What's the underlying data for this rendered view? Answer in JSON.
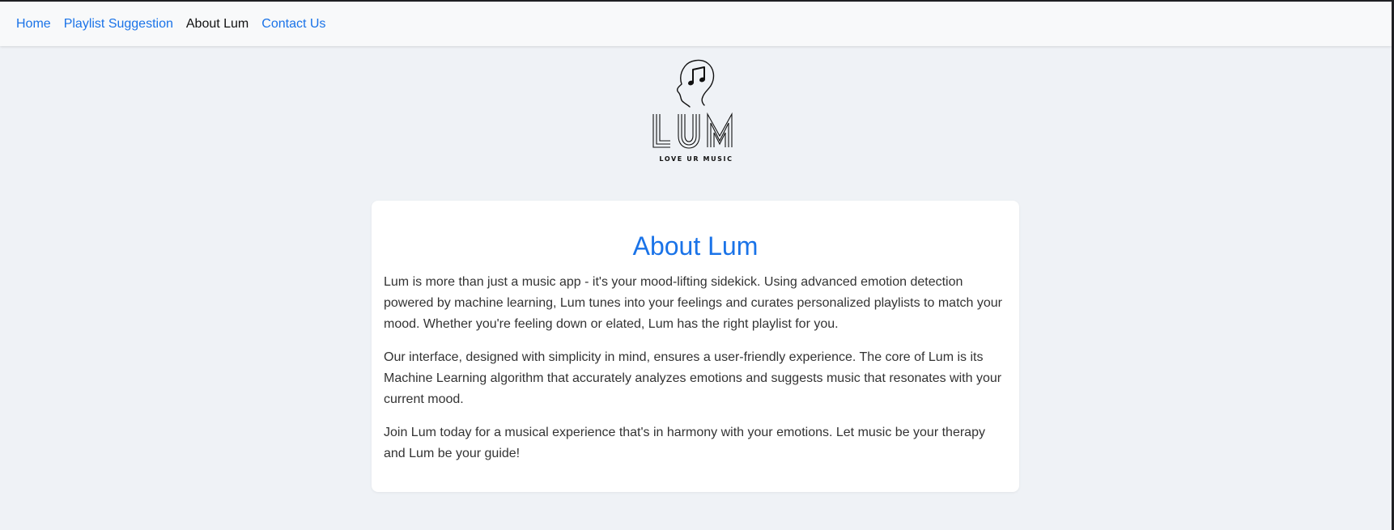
{
  "nav": {
    "items": [
      {
        "label": "Home",
        "active": false
      },
      {
        "label": "Playlist Suggestion",
        "active": false
      },
      {
        "label": "About Lum",
        "active": true
      },
      {
        "label": "Contact Us",
        "active": false
      }
    ]
  },
  "logo": {
    "name": "LUM",
    "tagline": "LOVE UR MUSIC",
    "icon": "head-with-music-note-icon"
  },
  "about": {
    "title": "About Lum",
    "paragraphs": [
      "Lum is more than just a music app - it's your mood-lifting sidekick. Using advanced emotion detection powered by machine learning, Lum tunes into your feelings and curates personalized playlists to match your mood. Whether you're feeling down or elated, Lum has the right playlist for you.",
      "Our interface, designed with simplicity in mind, ensures a user-friendly experience. The core of Lum is its Machine Learning algorithm that accurately analyzes emotions and suggests music that resonates with your current mood.",
      "Join Lum today for a musical experience that's in harmony with your emotions. Let music be your therapy and Lum be your guide!"
    ]
  },
  "colors": {
    "accent": "#1a73e8",
    "page_background": "#eff2f6",
    "navbar_background": "#f8f9fa",
    "card_background": "#ffffff",
    "text": "#333333"
  }
}
